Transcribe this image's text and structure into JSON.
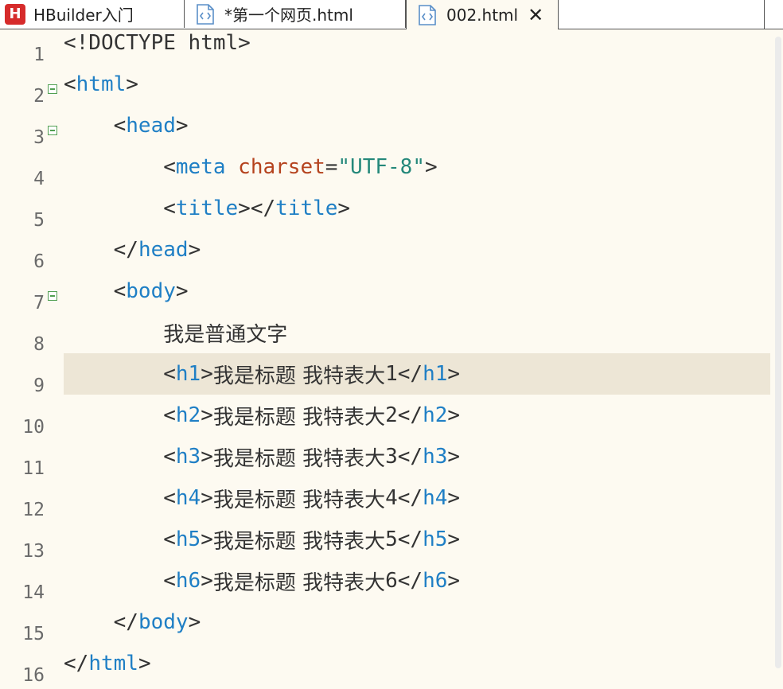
{
  "tabs": [
    {
      "label": "HBuilder入门",
      "icon": "hbuilder-logo-icon",
      "logo_letter": "H"
    },
    {
      "label": "*第一个网页.html",
      "icon": "html-file-icon"
    },
    {
      "label": "002.html",
      "icon": "html-file-icon",
      "active": true,
      "close": "✕"
    }
  ],
  "editor": {
    "line_numbers": [
      "1",
      "2",
      "3",
      "4",
      "5",
      "6",
      "7",
      "8",
      "9",
      "10",
      "11",
      "12",
      "13",
      "14",
      "15",
      "16"
    ],
    "current_line": "9",
    "colors": {
      "background": "#fdfaf1",
      "current_line": "#ede6d6",
      "tag": "#1f7fc5",
      "attribute": "#b5431e",
      "string": "#24887a",
      "fold_marker": "#52a052"
    },
    "lines": [
      {
        "indent": "",
        "tokens": [
          [
            "br",
            "<!DOCTYPE"
          ],
          [
            "t",
            " html>"
          ]
        ]
      },
      {
        "indent": "",
        "tokens": [
          [
            "br",
            "<"
          ],
          [
            "tag",
            "html"
          ],
          [
            "br",
            ">"
          ]
        ]
      },
      {
        "indent": "    ",
        "tokens": [
          [
            "br",
            "<"
          ],
          [
            "tag",
            "head"
          ],
          [
            "br",
            ">"
          ]
        ]
      },
      {
        "indent": "        ",
        "tokens": [
          [
            "br",
            "<"
          ],
          [
            "tag",
            "meta"
          ],
          [
            "t",
            " "
          ],
          [
            "attr",
            "charset"
          ],
          [
            "br",
            "="
          ],
          [
            "str",
            "\"UTF-8\""
          ],
          [
            "br",
            ">"
          ]
        ]
      },
      {
        "indent": "        ",
        "tokens": [
          [
            "br",
            "<"
          ],
          [
            "tag",
            "title"
          ],
          [
            "br",
            "></"
          ],
          [
            "tag",
            "title"
          ],
          [
            "br",
            ">"
          ]
        ]
      },
      {
        "indent": "    ",
        "tokens": [
          [
            "br",
            "</"
          ],
          [
            "tag",
            "head"
          ],
          [
            "br",
            ">"
          ]
        ]
      },
      {
        "indent": "    ",
        "tokens": [
          [
            "br",
            "<"
          ],
          [
            "tag",
            "body"
          ],
          [
            "br",
            ">"
          ]
        ]
      },
      {
        "indent": "        ",
        "tokens": [
          [
            "txt",
            "我是普通文字"
          ]
        ]
      },
      {
        "indent": "        ",
        "tokens": [
          [
            "br",
            "<"
          ],
          [
            "tag",
            "h1"
          ],
          [
            "br",
            ">"
          ],
          [
            "txt",
            "我是标题 我特表大"
          ],
          [
            "br",
            "1</"
          ],
          [
            "tag",
            "h1"
          ],
          [
            "br",
            ">"
          ]
        ]
      },
      {
        "indent": "        ",
        "tokens": [
          [
            "br",
            "<"
          ],
          [
            "tag",
            "h2"
          ],
          [
            "br",
            ">"
          ],
          [
            "txt",
            "我是标题 我特表大"
          ],
          [
            "br",
            "2</"
          ],
          [
            "tag",
            "h2"
          ],
          [
            "br",
            ">"
          ]
        ]
      },
      {
        "indent": "        ",
        "tokens": [
          [
            "br",
            "<"
          ],
          [
            "tag",
            "h3"
          ],
          [
            "br",
            ">"
          ],
          [
            "txt",
            "我是标题 我特表大"
          ],
          [
            "br",
            "3</"
          ],
          [
            "tag",
            "h3"
          ],
          [
            "br",
            ">"
          ]
        ]
      },
      {
        "indent": "        ",
        "tokens": [
          [
            "br",
            "<"
          ],
          [
            "tag",
            "h4"
          ],
          [
            "br",
            ">"
          ],
          [
            "txt",
            "我是标题 我特表大"
          ],
          [
            "br",
            "4</"
          ],
          [
            "tag",
            "h4"
          ],
          [
            "br",
            ">"
          ]
        ]
      },
      {
        "indent": "        ",
        "tokens": [
          [
            "br",
            "<"
          ],
          [
            "tag",
            "h5"
          ],
          [
            "br",
            ">"
          ],
          [
            "txt",
            "我是标题 我特表大"
          ],
          [
            "br",
            "5</"
          ],
          [
            "tag",
            "h5"
          ],
          [
            "br",
            ">"
          ]
        ]
      },
      {
        "indent": "        ",
        "tokens": [
          [
            "br",
            "<"
          ],
          [
            "tag",
            "h6"
          ],
          [
            "br",
            ">"
          ],
          [
            "txt",
            "我是标题 我特表大"
          ],
          [
            "br",
            "6</"
          ],
          [
            "tag",
            "h6"
          ],
          [
            "br",
            ">"
          ]
        ]
      },
      {
        "indent": "    ",
        "tokens": [
          [
            "br",
            "</"
          ],
          [
            "tag",
            "body"
          ],
          [
            "br",
            ">"
          ]
        ]
      },
      {
        "indent": "",
        "tokens": [
          [
            "br",
            "</"
          ],
          [
            "tag",
            "html"
          ],
          [
            "br",
            ">"
          ]
        ]
      }
    ],
    "fold_lines": [
      "2",
      "3",
      "7"
    ]
  }
}
